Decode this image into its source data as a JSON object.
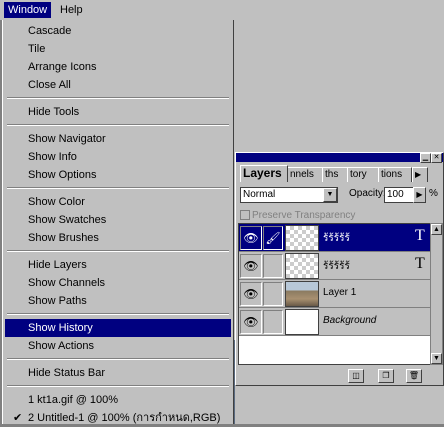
{
  "menubar": {
    "items": [
      {
        "label": "Window",
        "active": true
      },
      {
        "label": "Help",
        "active": false
      }
    ]
  },
  "menu": {
    "groups": [
      [
        {
          "label": "Cascade"
        },
        {
          "label": "Tile"
        },
        {
          "label": "Arrange Icons"
        },
        {
          "label": "Close All"
        }
      ],
      [
        {
          "label": "Hide Tools"
        }
      ],
      [
        {
          "label": "Show Navigator"
        },
        {
          "label": "Show Info"
        },
        {
          "label": "Show Options"
        }
      ],
      [
        {
          "label": "Show Color"
        },
        {
          "label": "Show Swatches"
        },
        {
          "label": "Show Brushes"
        }
      ],
      [
        {
          "label": "Hide Layers"
        },
        {
          "label": "Show Channels"
        },
        {
          "label": "Show Paths"
        }
      ],
      [
        {
          "label": "Show History",
          "highlighted": true
        },
        {
          "label": "Show Actions"
        }
      ],
      [
        {
          "label": "Hide Status Bar"
        }
      ],
      [
        {
          "label": "1 kt1a.gif @ 100%"
        },
        {
          "label": "2 Untitled-1 @ 100% (การกำหนด,RGB)",
          "checked": true
        }
      ]
    ]
  },
  "palette": {
    "tabs": [
      "Layers",
      "nnels",
      "ths",
      "tory",
      "tions"
    ],
    "active_tab": "Layers",
    "blend_mode": "Normal",
    "opacity_label": "Opacity:",
    "opacity_value": "100",
    "percent": "%",
    "preserve_transparency": "Preserve Transparency",
    "layers": [
      {
        "name": "ร้ร้ร้ร้ร้",
        "type": "text",
        "selected": true,
        "thumb": "checker"
      },
      {
        "name": "ร้ร้ร้ร้ร้",
        "type": "text",
        "selected": false,
        "thumb": "checker"
      },
      {
        "name": "Layer 1",
        "type": "image",
        "selected": false,
        "thumb": "photo"
      },
      {
        "name": "Background",
        "type": "background",
        "selected": false,
        "thumb": "white"
      }
    ]
  },
  "icons": {
    "eye": "eye-icon",
    "brush": "brush-icon",
    "text": "T",
    "new_layer": "new-layer-icon",
    "mask": "mask-icon",
    "trash": "trash-icon"
  },
  "colors": {
    "highlight": "#000080",
    "face": "#c0c0c0"
  }
}
